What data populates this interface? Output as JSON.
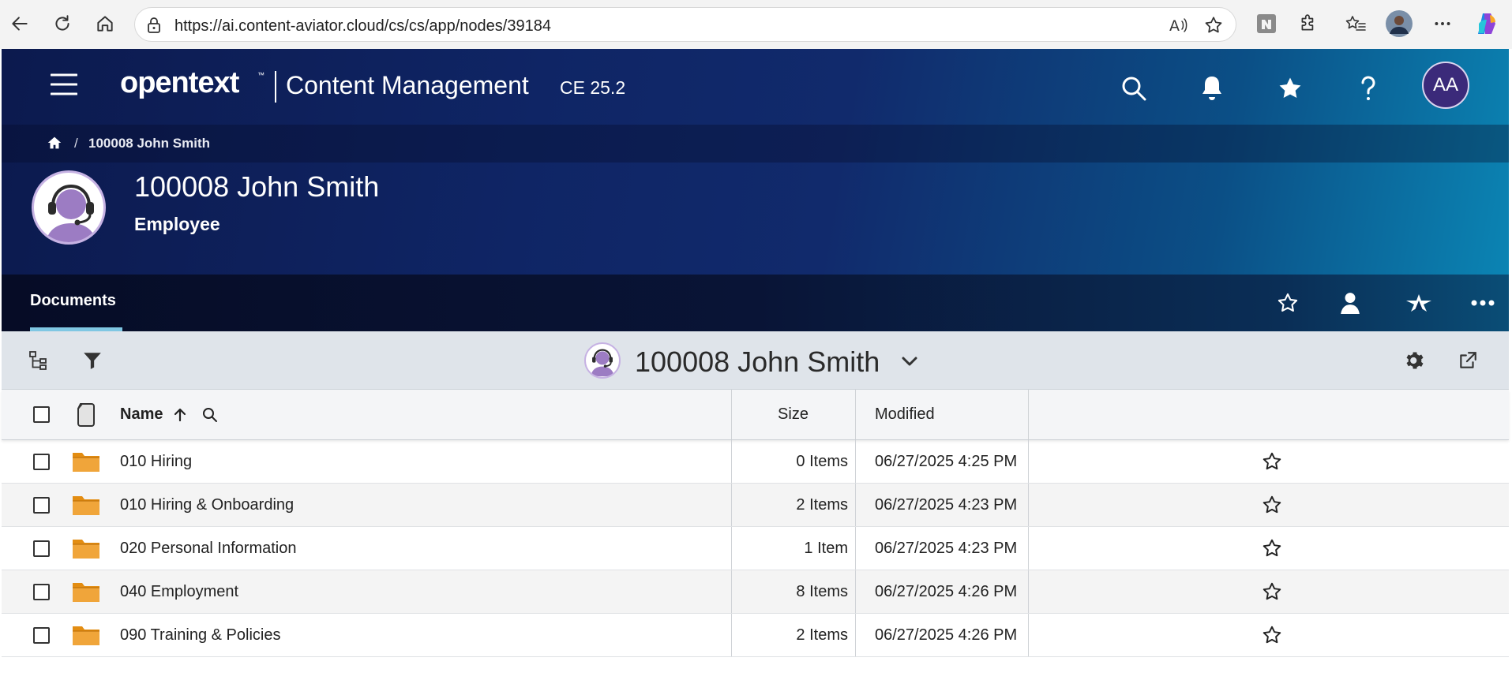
{
  "browser": {
    "url": "https://ai.content-aviator.cloud/cs/cs/app/nodes/39184"
  },
  "header": {
    "brand": "opentext",
    "brand_tm": "™",
    "product": "Content Management",
    "version": "CE 25.2",
    "user_initials": "AA"
  },
  "breadcrumb": {
    "separator": "/",
    "current": "100008 John Smith"
  },
  "workspace": {
    "title": "100008 John Smith",
    "subtitle": "Employee"
  },
  "tabs": [
    {
      "label": "Documents",
      "active": true
    }
  ],
  "toolbar": {
    "title": "100008 John Smith"
  },
  "table": {
    "columns": {
      "name": "Name",
      "size": "Size",
      "modified": "Modified"
    },
    "rows": [
      {
        "name": "010 Hiring",
        "size": "0 Items",
        "modified": "06/27/2025 4:25 PM"
      },
      {
        "name": "010 Hiring & Onboarding",
        "size": "2 Items",
        "modified": "06/27/2025 4:23 PM"
      },
      {
        "name": "020 Personal Information",
        "size": "1 Item",
        "modified": "06/27/2025 4:23 PM"
      },
      {
        "name": "040 Employment",
        "size": "8 Items",
        "modified": "06/27/2025 4:26 PM"
      },
      {
        "name": "090 Training & Policies",
        "size": "2 Items",
        "modified": "06/27/2025 4:26 PM"
      }
    ]
  },
  "icons": {
    "back": "back-arrow-icon",
    "refresh": "refresh-icon",
    "home": "home-icon",
    "lock": "lock-icon",
    "read_aloud": "read-aloud-icon",
    "favorite": "star-icon",
    "menu": "hamburger-icon",
    "search": "search-icon",
    "notifications": "bell-icon",
    "help": "help-icon",
    "filter": "filter-icon",
    "tree": "tree-icon",
    "settings": "gear-icon",
    "open_new": "open-external-icon",
    "folder": "folder-icon",
    "more": "more-icon"
  },
  "colors": {
    "header_dark": "#0c1a4e",
    "header_light": "#0b86b5",
    "folder": "#e38d12",
    "avatar_bg": "#3b2a7a",
    "tab_underline": "#7fc7e3"
  }
}
